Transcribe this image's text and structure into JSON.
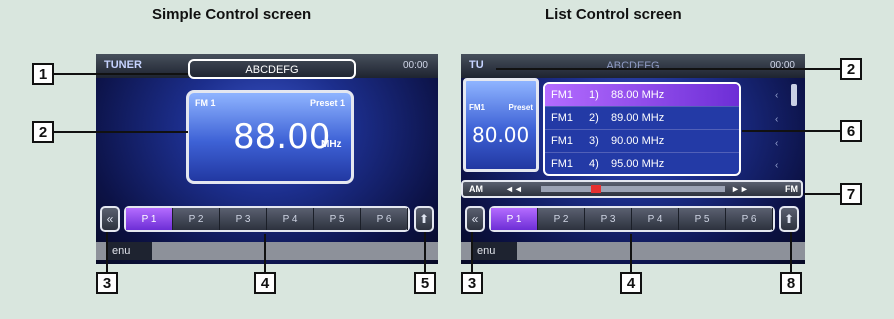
{
  "left_panel": {
    "title": "Simple Control screen",
    "tuner_label": "TUNER",
    "clock": "00:00",
    "station_name": "ABCDEFG",
    "band": "FM 1",
    "preset": "Preset 1",
    "frequency": "88.00",
    "unit": "MHz",
    "presets": [
      "P 1",
      "P 2",
      "P 3",
      "P 4",
      "P 5",
      "P 6"
    ],
    "active_preset": 0,
    "menu_label": "enu"
  },
  "right_panel": {
    "title": "List Control screen",
    "tuner_label": "TU",
    "station_name": "ABCDEFG",
    "clock": "00:00",
    "mini_band": "FM1",
    "mini_preset": "Preset",
    "mini_frequency": "80.00",
    "list": [
      {
        "band": "FM1",
        "num": "1)",
        "freq": "88.00 MHz"
      },
      {
        "band": "FM1",
        "num": "2)",
        "freq": "89.00 MHz"
      },
      {
        "band": "FM1",
        "num": "3)",
        "freq": "90.00 MHz"
      },
      {
        "band": "FM1",
        "num": "4)",
        "freq": "95.00 MHz"
      }
    ],
    "seek_left": "AM",
    "seek_right": "FM",
    "prev": "◄◄",
    "next": "►►",
    "presets": [
      "P 1",
      "P 2",
      "P 3",
      "P 4",
      "P 5",
      "P 6"
    ],
    "active_preset": 0,
    "menu_label": "enu"
  },
  "callouts": {
    "c1": "1",
    "c2": "2",
    "c3": "3",
    "c4": "4",
    "c5": "5",
    "r2": "2",
    "r6": "6",
    "r7": "7",
    "r3": "3",
    "r4": "4",
    "r8": "8"
  },
  "icons": {
    "collapse": "«",
    "eject": "⬆"
  }
}
